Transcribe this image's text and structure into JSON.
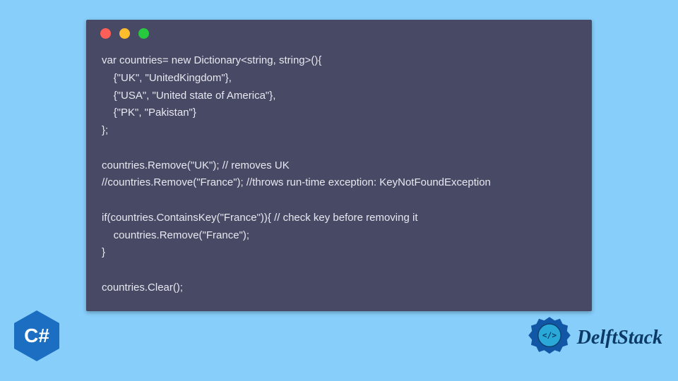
{
  "code": {
    "lines": [
      "var countries= new Dictionary<string, string>(){",
      "    {\"UK\", \"UnitedKingdom\"},",
      "    {\"USA\", \"United state of America\"},",
      "    {\"PK\", \"Pakistan\"}",
      "};",
      "",
      "countries.Remove(\"UK\"); // removes UK",
      "//countries.Remove(\"France\"); //throws run-time exception: KeyNotFoundException",
      "",
      "if(countries.ContainsKey(\"France\")){ // check key before removing it",
      "    countries.Remove(\"France\");",
      "}",
      "",
      "countries.Clear();"
    ]
  },
  "csharp_badge": {
    "label": "C#"
  },
  "brand": {
    "name": "DelftStack"
  },
  "colors": {
    "page_bg": "#87cefa",
    "window_bg": "#474965",
    "code_fg": "#e8e8f0",
    "badge_bg": "#1b6ec2",
    "brand_fg": "#0b3a66",
    "traffic_red": "#ff5f56",
    "traffic_yellow": "#ffbd2e",
    "traffic_green": "#27c93f"
  }
}
